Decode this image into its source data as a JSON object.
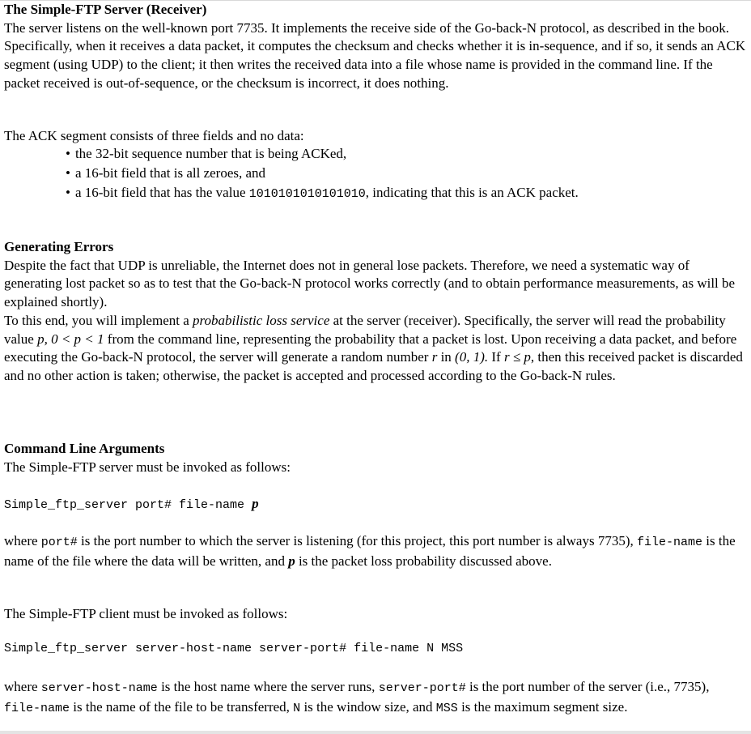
{
  "s1": {
    "heading": "The Simple-FTP Server (Receiver)",
    "p1": "The server listens on the well-known port 7735. It implements the receive side of the Go-back-N protocol, as described in the book. Specifically, when it receives a data packet, it computes the checksum and checks whether it is in-sequence, and if so, it sends an ACK segment (using UDP) to the client; it then writes the received data into a file whose name is provided in the command line. If the packet received is out-of-sequence, or the checksum is incorrect, it does nothing.",
    "p2": "The ACK segment consists of three fields and no data:",
    "bullet1": "the 32-bit sequence number that is being ACKed,",
    "bullet2": "a 16-bit field that is all zeroes, and",
    "bullet3_pre": "a 16-bit field that has the value ",
    "bullet3_code": "1010101010101010",
    "bullet3_post": ", indicating that this is an ACK packet."
  },
  "s2": {
    "heading": "Generating Errors",
    "p1": "Despite the fact that UDP is unreliable, the Internet does not in general lose packets. Therefore, we need a systematic way of generating lost packet so as to test that the Go-back-N protocol works correctly (and to obtain performance measurements, as will be explained shortly).",
    "p2_a": "To this end, you will implement a ",
    "p2_b": "probabilistic loss service",
    "p2_c": " at the server (receiver). Specifically, the server will read the probability value ",
    "p2_d": "p, 0 < p < 1",
    "p2_e": " from the command line, representing the probability that a packet is lost. Upon receiving a data packet, and before executing the Go-back-N protocol, the server will generate a random number ",
    "p2_f": "r",
    "p2_g": " in ",
    "p2_h": "(0, 1).",
    "p2_i": " If ",
    "p2_j": "r ≤ p",
    "p2_k": ", then this received packet is discarded and no other action is taken; otherwise, the packet is accepted and processed according to the Go-back-N rules."
  },
  "s3": {
    "heading": "Command Line Arguments",
    "p1": "The Simple-FTP server must be invoked as follows:",
    "cmd1_code": "Simple_ftp_server port# file-name ",
    "cmd1_p": "p",
    "p2_a": "where ",
    "p2_b": "port#",
    "p2_c": " is the port number to which the server is listening (for this project, this port number is always 7735), ",
    "p2_d": "file-name",
    "p2_e": " is the name of the file where the data will be written, and ",
    "p2_f": "p",
    "p2_g": " is the packet loss probability discussed above.",
    "p3": "The Simple-FTP client must be invoked as follows:",
    "cmd2_code": "Simple_ftp_server server-host-name server-port# file-name N MSS",
    "p4_a": "where ",
    "p4_b": "server-host-name",
    "p4_c": " is the host name where the server runs, ",
    "p4_d": "server-port#",
    "p4_e": " is the port number of the server (i.e., 7735), ",
    "p4_f": "file-name",
    "p4_g": " is the name of the file to be transferred, ",
    "p4_h": "N",
    "p4_i": " is the window size, and ",
    "p4_j": "MSS",
    "p4_k": " is the maximum segment size."
  }
}
